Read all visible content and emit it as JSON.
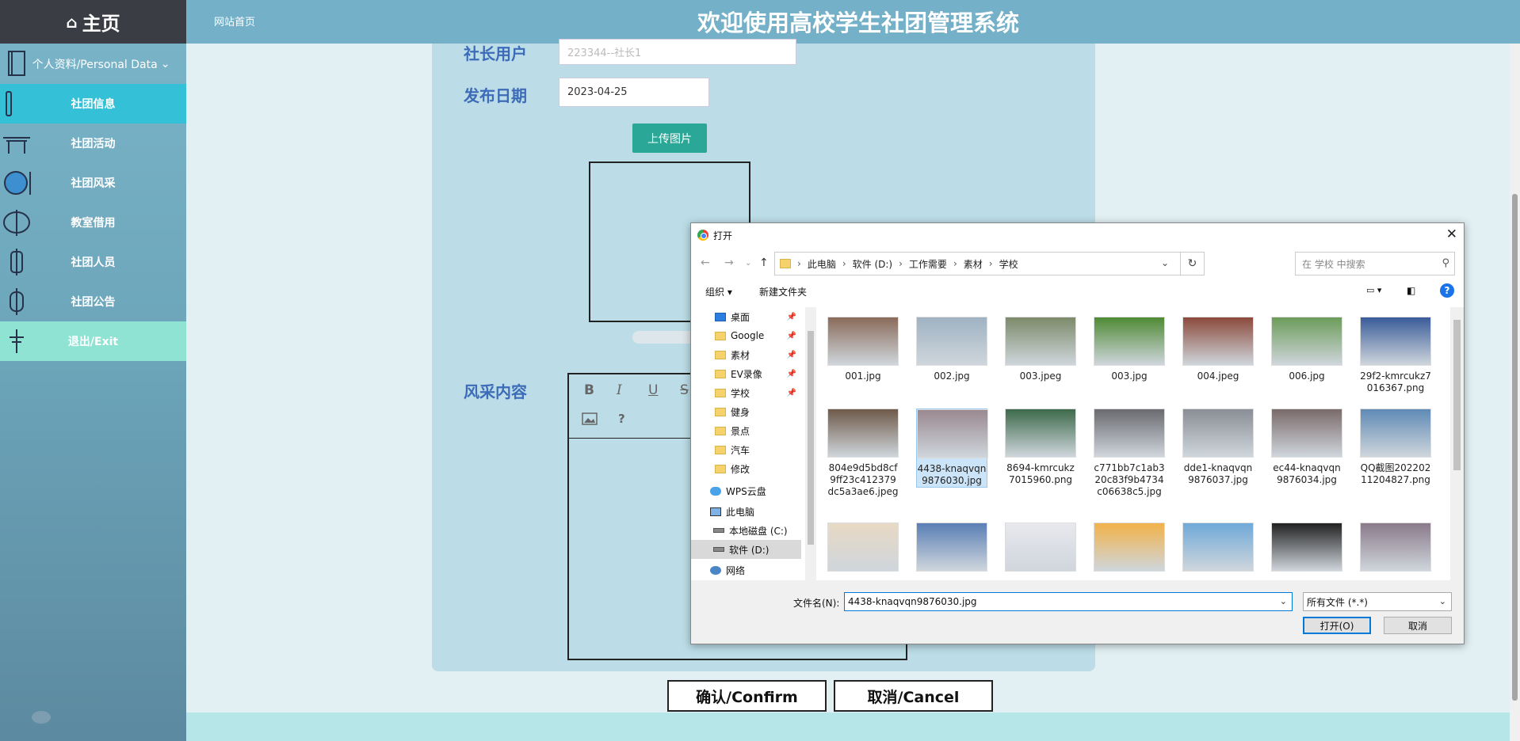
{
  "sidebar": {
    "home_label": "主页",
    "home_icon": "house-icon",
    "items": [
      {
        "label": "个人资料/Personal Data",
        "icon": "notebook-icon"
      },
      {
        "label": "社团信息",
        "icon": "scroll-icon"
      },
      {
        "label": "社团活动",
        "icon": "gate-icon"
      },
      {
        "label": "社团风采",
        "icon": "mirror-icon"
      },
      {
        "label": "教室借用",
        "icon": "lantern-icon"
      },
      {
        "label": "社团人员",
        "icon": "lantern-tall-icon"
      },
      {
        "label": "社团公告",
        "icon": "lantern-round-icon"
      },
      {
        "label": "退出/Exit",
        "icon": "knot-icon"
      }
    ]
  },
  "header": {
    "home_link": "网站首页",
    "title": "欢迎使用高校学生社团管理系统"
  },
  "form": {
    "leader_label": "社长用户",
    "leader_value": "223344--社长1",
    "date_label": "发布日期",
    "date_value": "2023-04-25",
    "upload_label": "上传图片",
    "content_label": "风采内容",
    "editor_tools": [
      "B",
      "I",
      "U",
      "S",
      "image",
      "?"
    ],
    "confirm_label": "确认/Confirm",
    "cancel_label": "取消/Cancel"
  },
  "dialog": {
    "title": "打开",
    "close": "✕",
    "path": [
      "此电脑",
      "软件 (D:)",
      "工作需要",
      "素材",
      "学校"
    ],
    "search_placeholder": "在 学校 中搜索",
    "organize": "组织 ▾",
    "new_folder": "新建文件夹",
    "help": "?",
    "tree": [
      {
        "label": "桌面",
        "pinned": true,
        "type": "desktop"
      },
      {
        "label": "Google",
        "pinned": true,
        "type": "folder"
      },
      {
        "label": "素材",
        "pinned": true,
        "type": "folder"
      },
      {
        "label": "EV录像",
        "pinned": true,
        "type": "folder"
      },
      {
        "label": "学校",
        "pinned": true,
        "type": "folder"
      },
      {
        "label": "健身",
        "pinned": false,
        "type": "folder"
      },
      {
        "label": "景点",
        "pinned": false,
        "type": "folder"
      },
      {
        "label": "汽车",
        "pinned": false,
        "type": "folder"
      },
      {
        "label": "修改",
        "pinned": false,
        "type": "folder"
      },
      {
        "label": "WPS云盘",
        "pinned": false,
        "type": "cloud"
      },
      {
        "label": "此电脑",
        "pinned": false,
        "type": "pc"
      },
      {
        "label": "本地磁盘 (C:)",
        "pinned": false,
        "type": "drive"
      },
      {
        "label": "软件 (D:)",
        "pinned": false,
        "type": "drive"
      },
      {
        "label": "网络",
        "pinned": false,
        "type": "network"
      }
    ],
    "files": [
      {
        "name": "001.jpg",
        "color": "#8a6b5a"
      },
      {
        "name": "002.jpg",
        "color": "#9fb2c2"
      },
      {
        "name": "003.jpeg",
        "color": "#7d8a6a"
      },
      {
        "name": "003.jpg",
        "color": "#4f8a35"
      },
      {
        "name": "004.jpeg",
        "color": "#8b4a3c"
      },
      {
        "name": "006.jpg",
        "color": "#6c9c5a"
      },
      {
        "name": "29f2-kmrcukz7016367.png",
        "color": "#3a5c9a"
      },
      {
        "name": "804e9d5bd8cf9ff23c412379dc5a3ae6.jpeg",
        "color": "#6e5a4a"
      },
      {
        "name": "4438-knaqvqn9876030.jpg",
        "color": "#9a8890"
      },
      {
        "name": "8694-kmrcukz7015960.png",
        "color": "#3d6a4a"
      },
      {
        "name": "c771bb7c1ab320c83f9b4734c06638c5.jpg",
        "color": "#6a6a70"
      },
      {
        "name": "dde1-knaqvqn9876037.jpg",
        "color": "#8a8e96"
      },
      {
        "name": "ec44-knaqvqn9876034.jpg",
        "color": "#7a6a6a"
      },
      {
        "name": "QQ截图20220211204827.png",
        "color": "#5f8ab5"
      },
      {
        "name": "",
        "color": "#e8d9c4"
      },
      {
        "name": "",
        "color": "#5a7fb5"
      },
      {
        "name": "",
        "color": "#e8e8ee"
      },
      {
        "name": "",
        "color": "#f2b24a"
      },
      {
        "name": "",
        "color": "#6fa9d8"
      },
      {
        "name": "",
        "color": "#222222"
      },
      {
        "name": "",
        "color": "#8a7a8a"
      }
    ],
    "selected_file": "4438-knaqvqn9876030.jpg",
    "filename_label": "文件名(N):",
    "filename_value": "4438-knaqvqn9876030.jpg",
    "filetype_value": "所有文件 (*.*)",
    "open_label": "打开(O)",
    "cancel_label": "取消"
  }
}
